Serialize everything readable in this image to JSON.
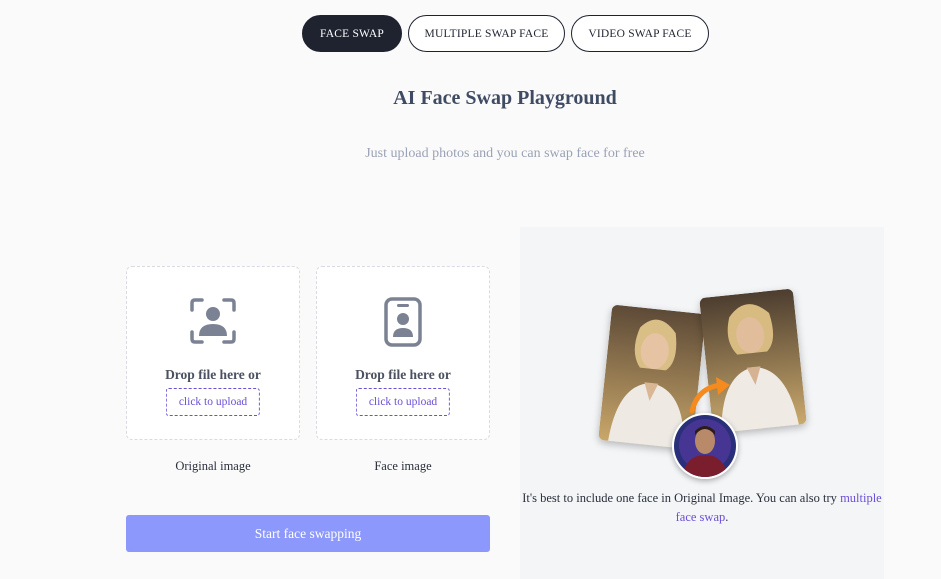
{
  "tabs": [
    {
      "label": "FACE SWAP",
      "active": true
    },
    {
      "label": "MULTIPLE SWAP FACE",
      "active": false
    },
    {
      "label": "VIDEO SWAP FACE",
      "active": false
    }
  ],
  "header": {
    "title": "AI Face Swap Playground",
    "subtitle": "Just upload photos and you can swap face for free"
  },
  "uploads": [
    {
      "icon": "user-frame-icon",
      "drop_text": "Drop file here or",
      "button_label": "click to upload",
      "caption": "Original image"
    },
    {
      "icon": "id-badge-icon",
      "drop_text": "Drop file here or",
      "button_label": "click to upload",
      "caption": "Face image"
    }
  ],
  "start_button": {
    "label": "Start face swapping"
  },
  "tip": {
    "text": "It's best to include one face in Original Image. You can also try ",
    "link_label": "multiple face swap",
    "suffix": "."
  },
  "colors": {
    "accent": "#6b4fd6",
    "primary_button": "#8c98fb",
    "active_tab": "#1f2330",
    "icon_gray": "#7b8294"
  }
}
